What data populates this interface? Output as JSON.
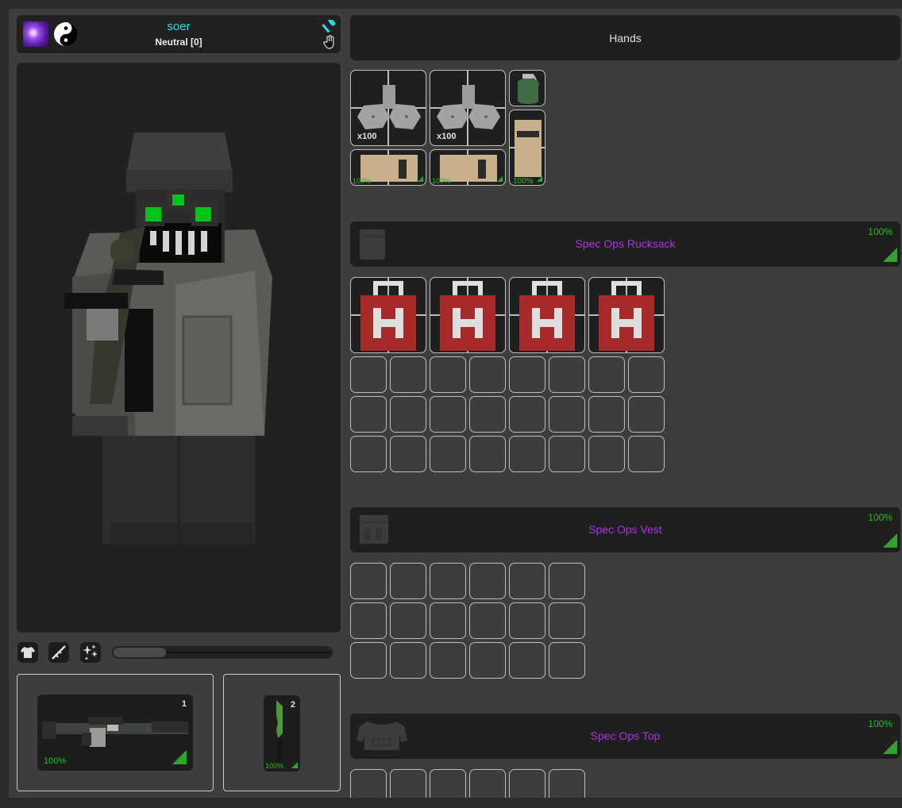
{
  "player": {
    "name": "soer",
    "reputation": "Neutral [0]"
  },
  "hands": {
    "title": "Hands",
    "items": [
      {
        "name": "grey-ammo-box",
        "quantity": "x100"
      },
      {
        "name": "grey-ammo-box",
        "quantity": "x100"
      },
      {
        "name": "green-grenade"
      },
      {
        "name": "tan-armor-plate",
        "condition": "100%"
      },
      {
        "name": "tan-armor-plate",
        "condition": "100%"
      },
      {
        "name": "tan-armor-plate-tall",
        "condition": "100%"
      }
    ]
  },
  "backpack": {
    "title": "Spec Ops Rucksack",
    "condition": "100%",
    "medkit_count": 4
  },
  "vest": {
    "title": "Spec Ops Vest",
    "condition": "100%"
  },
  "shirt": {
    "title": "Spec Ops Top",
    "condition": "100%"
  },
  "equipment": {
    "primary": {
      "slot": "1",
      "condition": "100%"
    },
    "secondary": {
      "slot": "2",
      "condition": "100%"
    }
  },
  "colors": {
    "name": "#22e3ea",
    "rarity": "#b030e8",
    "condition": "#2fbb2f",
    "medkit": "#a62a2a"
  }
}
